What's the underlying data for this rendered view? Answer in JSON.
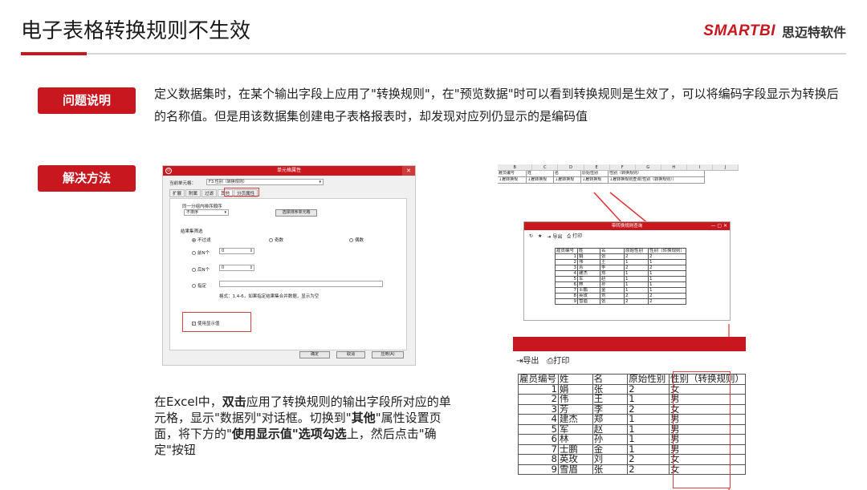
{
  "page": {
    "title": "电子表格转换规则不生效",
    "logo_word": "SMARTBI",
    "logo_cn": "思迈特软件"
  },
  "problem": {
    "tag": "问题说明",
    "text": "定义数据集时，在某个输出字段上应用了\"转换规则\"，在\"预览数据\"时可以看到转换规则是生效了，可以将编码字段显示为转换后的名称值。但是用该数据集创建电子表格报表时，却发现对应列仍显示的是编码值"
  },
  "solution": {
    "tag": "解决方法",
    "desc_parts": [
      "在Excel中，",
      "双击",
      "应用了转换规则的输出字段所对应的单元格，显示\"数据列\"对话框。切换到\"",
      "其他",
      "\"属性设置页面，将下方的\"",
      "使用显示值\"选项勾选",
      "上，然后点击\"确定\"按钮"
    ]
  },
  "dialog": {
    "title": "单元格属性",
    "cell_label": "当前单元格：",
    "cell_value": "F3:性别（转换规则）",
    "tabs": [
      "扩展",
      "附属",
      "过滤",
      "其他",
      "分页属性"
    ],
    "sort_group": "同一分组内排序顺序",
    "sort_value": "不排序",
    "sort_button": "选择排序单元格",
    "filter_group": "结果集筛选",
    "opt_none": "不过滤",
    "opt_odd": "奇数",
    "opt_even": "偶数",
    "opt_first": "前N个",
    "opt_last": "后N个",
    "opt_specify": "指定",
    "first_value": "0",
    "last_value": "0",
    "format_hint": "格式：1,4-6，如果指定结果集合并数据，显示为空",
    "use_display": "使用显示值",
    "ok": "确定",
    "cancel": "取消",
    "apply": "应用(A)"
  },
  "sheet": {
    "col_letters": [
      "B",
      "C",
      "D",
      "E",
      "F",
      "G",
      "H",
      "I",
      "J"
    ],
    "row1": [
      "雇员编号",
      "姓",
      "名",
      "原始性别",
      "性别（转换规则）"
    ],
    "row2": [
      "↓雇转换规",
      "↓雇转换规",
      "↓雇转换规",
      "↓雇转换规",
      "↓雇转换规则查询(性别（转换规则））"
    ]
  },
  "popup": {
    "title": "带转换规则查询",
    "toolbar": [
      "导出",
      "打印"
    ],
    "headers": [
      "雇员编号",
      "姓",
      "名",
      "原始性别",
      "性别（转换规则）"
    ],
    "rows": [
      [
        "1",
        "娟",
        "张",
        "2",
        "2"
      ],
      [
        "2",
        "伟",
        "王",
        "1",
        "1"
      ],
      [
        "3",
        "芳",
        "李",
        "2",
        "2"
      ],
      [
        "4",
        "建杰",
        "郑",
        "1",
        "1"
      ],
      [
        "5",
        "军",
        "赵",
        "1",
        "1"
      ],
      [
        "6",
        "林",
        "孙",
        "1",
        "1"
      ],
      [
        "7",
        "士鹏",
        "金",
        "1",
        "1"
      ],
      [
        "8",
        "英玫",
        "刘",
        "2",
        "2"
      ],
      [
        "9",
        "雪眉",
        "张",
        "2",
        "2"
      ]
    ]
  },
  "result": {
    "toolbar": [
      "导出",
      "打印"
    ],
    "headers": [
      "雇员编号",
      "姓",
      "名",
      "原始性别",
      "性别（转换规则）"
    ],
    "rows": [
      [
        "1",
        "娟",
        "张",
        "2",
        "女"
      ],
      [
        "2",
        "伟",
        "王",
        "1",
        "男"
      ],
      [
        "3",
        "芳",
        "李",
        "2",
        "女"
      ],
      [
        "4",
        "建杰",
        "郑",
        "1",
        "男"
      ],
      [
        "5",
        "军",
        "赵",
        "1",
        "男"
      ],
      [
        "6",
        "林",
        "孙",
        "1",
        "男"
      ],
      [
        "7",
        "士鹏",
        "金",
        "1",
        "男"
      ],
      [
        "8",
        "英玫",
        "刘",
        "2",
        "女"
      ],
      [
        "9",
        "雪眉",
        "张",
        "2",
        "女"
      ]
    ]
  }
}
